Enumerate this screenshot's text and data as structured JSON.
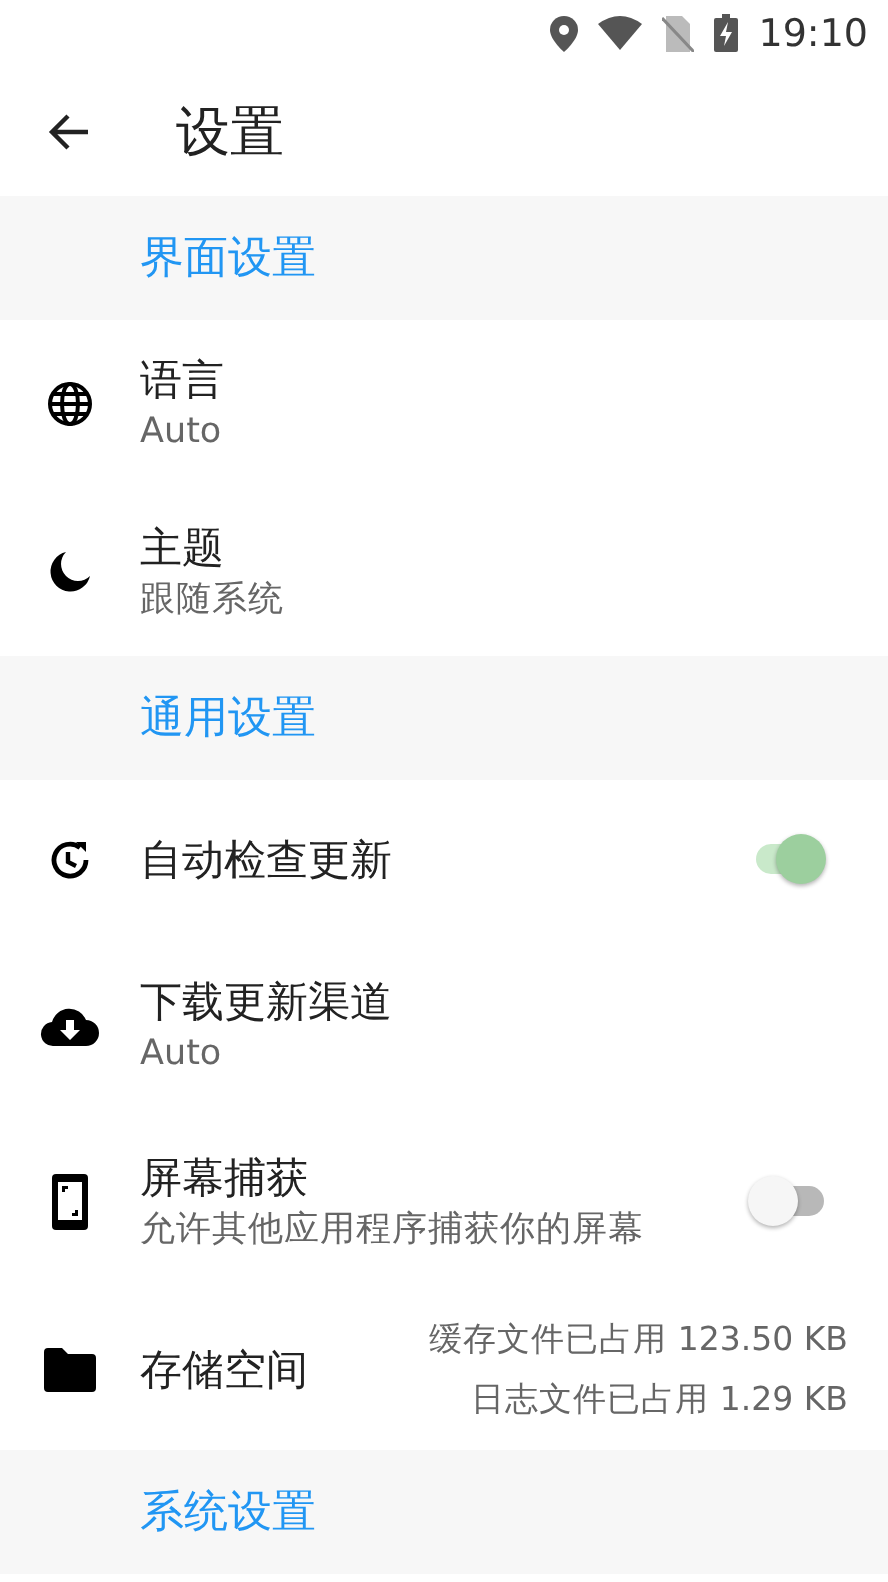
{
  "status_bar": {
    "time": "19:10"
  },
  "app_bar": {
    "title": "设置"
  },
  "sections": [
    {
      "title": "界面设置",
      "items": [
        {
          "kind": "value",
          "title": "语言",
          "subtitle": "Auto"
        },
        {
          "kind": "value",
          "title": "主题",
          "subtitle": "跟随系统"
        }
      ]
    },
    {
      "title": "通用设置",
      "items": [
        {
          "kind": "switch",
          "title": "自动检查更新",
          "on": true
        },
        {
          "kind": "value",
          "title": "下载更新渠道",
          "subtitle": "Auto"
        },
        {
          "kind": "switch",
          "title": "屏幕捕获",
          "subtitle": "允许其他应用程序捕获你的屏幕",
          "on": false
        },
        {
          "kind": "storage",
          "title": "存储空间",
          "lines": [
            "缓存文件已占用 123.50 KB",
            "日志文件已占用 1.29 KB"
          ]
        }
      ]
    },
    {
      "title": "系统设置"
    }
  ]
}
